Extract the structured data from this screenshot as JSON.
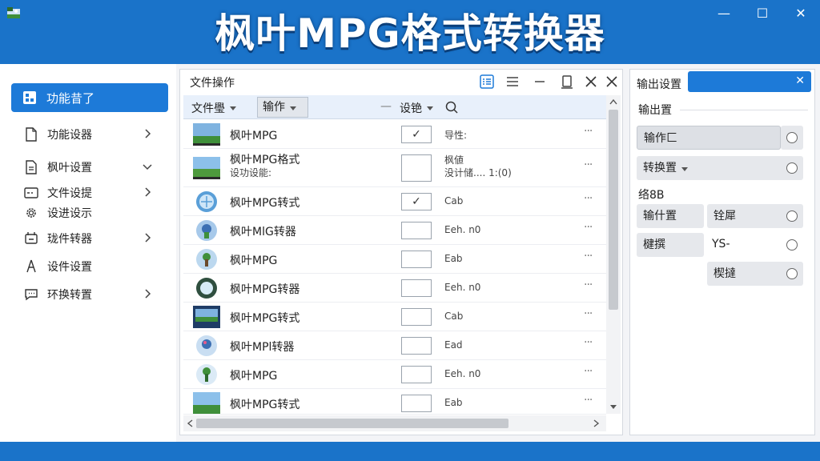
{
  "window": {
    "title": "枫叶MPG格式转换器",
    "minimize": "—",
    "maximize": "☐",
    "close": "✕"
  },
  "sidebar": {
    "active": "功能昔了",
    "items": [
      {
        "label": "功能设器"
      },
      {
        "label": "枫叶设置"
      },
      {
        "label": "文件设提"
      },
      {
        "label": "设进设示"
      },
      {
        "label": "珑件转器"
      },
      {
        "label": "设件设置"
      },
      {
        "label": "环换转置"
      }
    ]
  },
  "files": {
    "title": "文件操作",
    "header": {
      "col1": "文件璺",
      "combo": "输作",
      "col3": "设铯"
    },
    "rows": [
      {
        "name": "枫叶MPG",
        "sub": "",
        "checked": "✓",
        "info": "导性:",
        "info2": "",
        "dots": "···"
      },
      {
        "name": "枫叶MPG格式",
        "sub": "设功设能:",
        "checked": "",
        "info": "枫値",
        "info2": "没计储.... 1:(0)",
        "dots": "···"
      },
      {
        "name": "枫叶MPG转式",
        "sub": "",
        "checked": "✓",
        "info": "Cab",
        "info2": "",
        "dots": "···"
      },
      {
        "name": "枫叶MlG转器",
        "sub": "",
        "checked": "",
        "info": "Eeh. n0",
        "info2": "",
        "dots": "···"
      },
      {
        "name": "枫叶MPG",
        "sub": "",
        "checked": "",
        "info": "Eab",
        "info2": "",
        "dots": "···"
      },
      {
        "name": "枫叶MPG转器",
        "sub": "",
        "checked": "",
        "info": "Eeh. n0",
        "info2": "",
        "dots": "···"
      },
      {
        "name": "枫叶MPG转式",
        "sub": "",
        "checked": "",
        "info": "Cab",
        "info2": "",
        "dots": "···"
      },
      {
        "name": "枫叶MPl转器",
        "sub": "",
        "checked": "",
        "info": "Ead",
        "info2": "",
        "dots": "···"
      },
      {
        "name": "枫叶MPG",
        "sub": "",
        "checked": "",
        "info": "Eeh. n0",
        "info2": "",
        "dots": "···"
      },
      {
        "name": "枫叶MPG转式",
        "sub": "",
        "checked": "",
        "info": "Eab",
        "info2": "",
        "dots": "···"
      }
    ]
  },
  "output": {
    "title": "输出设置",
    "close": "✕",
    "section1": "输出置",
    "field1": "输作匚",
    "field2": "转换置",
    "section2": "络8B",
    "btn_a": "输什置",
    "btn_b": "铨犀",
    "btn_c": "楗撰",
    "text_ys": "YS-",
    "btn_d": "楔撻"
  },
  "colors": {
    "accent": "#1d7ad8",
    "titlebar": "#1a73c9"
  }
}
